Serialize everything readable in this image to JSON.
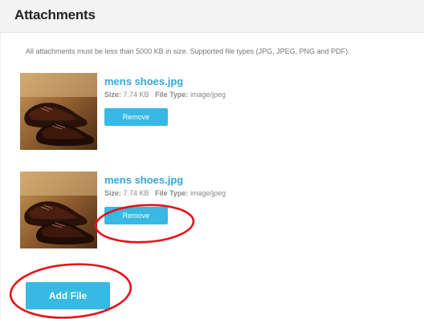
{
  "header": {
    "title": "Attachments"
  },
  "note": "All attachments must be less than 5000 KB in size. Supported file types (JPG, JPEG, PNG and PDF).",
  "attachments": [
    {
      "name": "mens shoes.jpg",
      "size_label": "Size:",
      "size": "7.74 KB",
      "type_label": "File Type:",
      "type": "image/jpeg",
      "remove_label": "Remove"
    },
    {
      "name": "mens shoes.jpg",
      "size_label": "Size:",
      "size": "7.74 KB",
      "type_label": "File Type:",
      "type": "image/jpeg",
      "remove_label": "Remove"
    }
  ],
  "add_file_label": "Add File",
  "colors": {
    "accent": "#37b9e3",
    "link": "#35a7dd",
    "annotation": "#e8101a"
  }
}
